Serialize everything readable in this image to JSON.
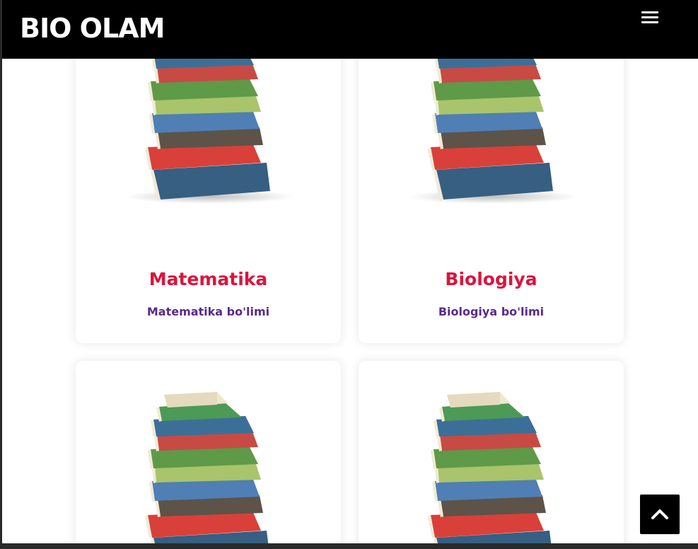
{
  "navbar": {
    "brand": "BIO OLAM",
    "menu_icon": "hamburger-icon"
  },
  "cards": [
    {
      "title": "Matematika",
      "subtitle": "Matematika bo'limi",
      "image_icon": "book-stack-image"
    },
    {
      "title": "Biologiya",
      "subtitle": "Biologiya bo'limi",
      "image_icon": "book-stack-image"
    },
    {
      "title": "",
      "subtitle": "",
      "image_icon": "book-stack-image"
    },
    {
      "title": "",
      "subtitle": "",
      "image_icon": "book-stack-image"
    }
  ],
  "scroll_top": {
    "icon": "chevron-up-icon"
  },
  "colors": {
    "navbar_bg": "#000000",
    "title": "#dc143c",
    "subtitle": "#5b2a8c"
  }
}
